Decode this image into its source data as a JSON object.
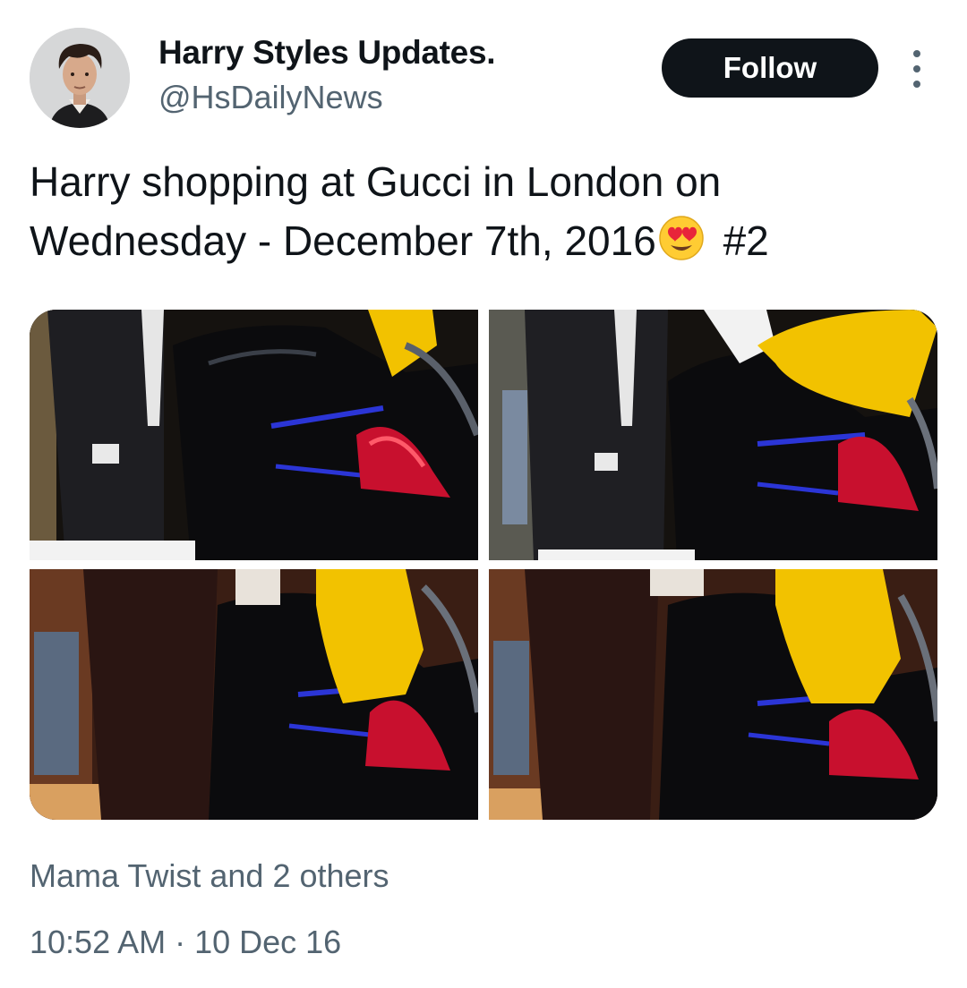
{
  "header": {
    "display_name": "Harry Styles Updates.",
    "handle": "@HsDailyNews",
    "follow_label": "Follow",
    "avatar_icon": "user-avatar",
    "more_icon": "more-vertical-icon"
  },
  "tweet": {
    "text_line": "Harry shopping at Gucci in London on Wednesday - December 7th, 2016",
    "emoji": "heart-eyes-emoji",
    "tag": "#2"
  },
  "media": [
    {
      "label": "photo-1"
    },
    {
      "label": "photo-2"
    },
    {
      "label": "photo-3"
    },
    {
      "label": "photo-4"
    }
  ],
  "footer": {
    "likes_text": "Mama Twist and 2 others",
    "timestamp": "10:52 AM · 10 Dec 16"
  },
  "colors": {
    "button_bg": "#0f1419",
    "secondary_text": "#536471",
    "yellow_jacket": "#f2c200",
    "taillight": "#c8102e"
  }
}
